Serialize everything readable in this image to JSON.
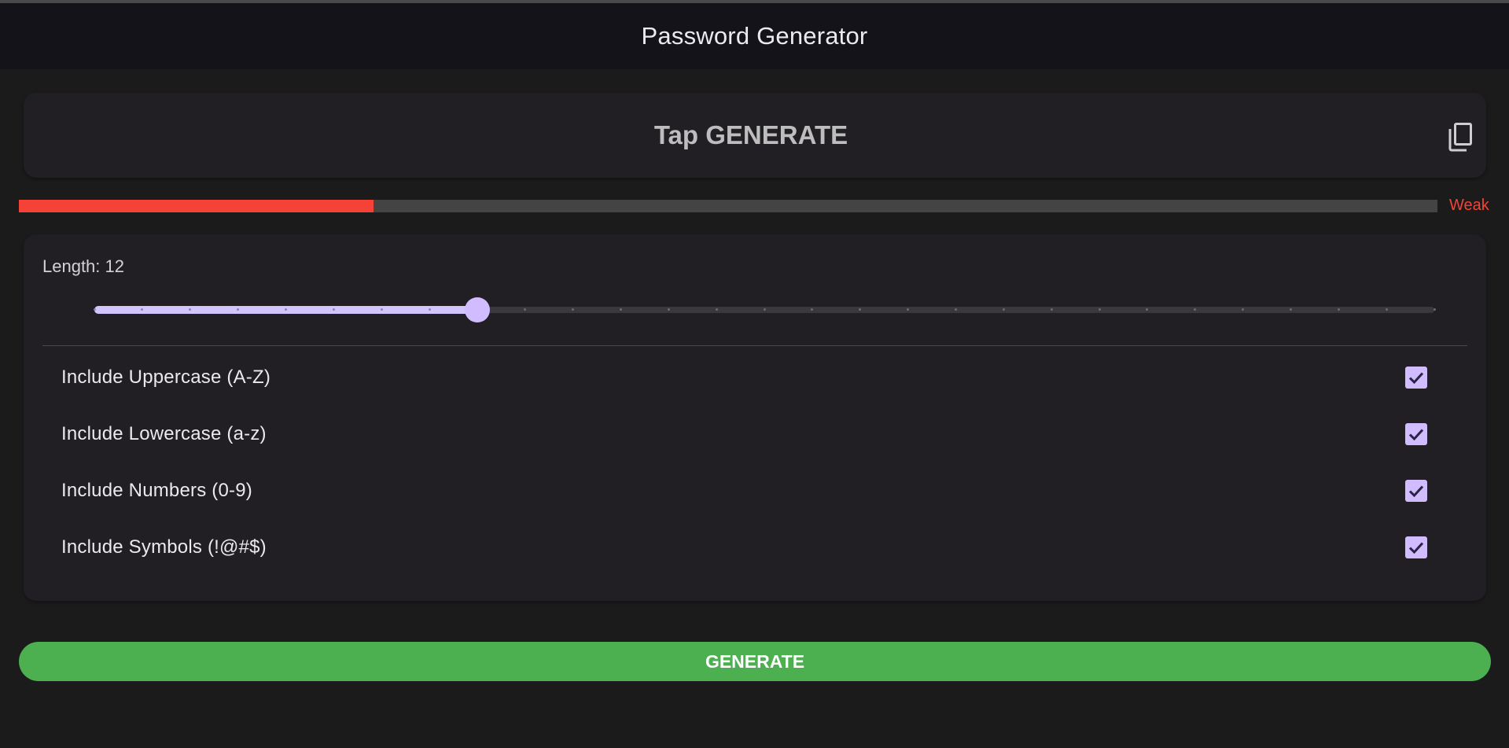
{
  "appbar": {
    "title": "Password Generator"
  },
  "password": {
    "placeholder_text": "Tap GENERATE",
    "copy_icon": "copy-icon"
  },
  "strength": {
    "label": "Weak",
    "fill_fraction": 0.25,
    "color": "#f44336"
  },
  "length": {
    "label": "Length: 12",
    "value": 12,
    "min": 4,
    "max": 32,
    "divisions": 28
  },
  "options": [
    {
      "label": "Include Uppercase (A-Z)",
      "checked": true
    },
    {
      "label": "Include Lowercase (a-z)",
      "checked": true
    },
    {
      "label": "Include Numbers (0-9)",
      "checked": true
    },
    {
      "label": "Include Symbols (!@#$)",
      "checked": true
    }
  ],
  "generate": {
    "label": "GENERATE",
    "color": "#4caf50"
  },
  "colors": {
    "accent": "#d0bcff",
    "background": "#1b1b1c",
    "card": "#211f24"
  }
}
